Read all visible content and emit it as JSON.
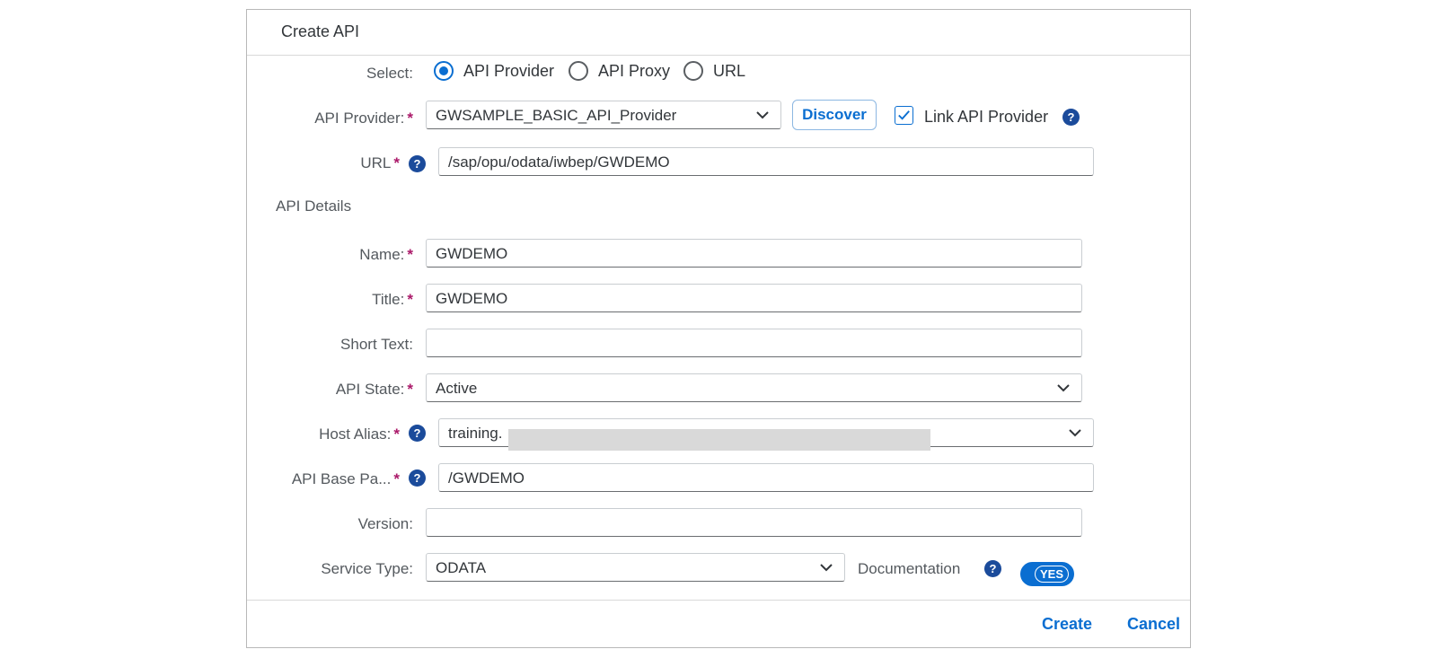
{
  "dialog": {
    "title": "Create API",
    "create_label": "Create",
    "cancel_label": "Cancel"
  },
  "select": {
    "label": "Select:",
    "options": [
      {
        "label": "API Provider",
        "checked": true
      },
      {
        "label": "API Proxy",
        "checked": false
      },
      {
        "label": "URL",
        "checked": false
      }
    ]
  },
  "api_provider": {
    "label": "API Provider:",
    "value": "GWSAMPLE_BASIC_API_Provider",
    "discover_label": "Discover",
    "link_label": "Link API Provider",
    "link_checked": true
  },
  "url": {
    "label": "URL",
    "value": "/sap/opu/odata/iwbep/GWDEMO"
  },
  "details": {
    "section_title": "API Details",
    "name": {
      "label": "Name:",
      "value": "GWDEMO"
    },
    "title": {
      "label": "Title:",
      "value": "GWDEMO"
    },
    "short_text": {
      "label": "Short Text:",
      "value": ""
    },
    "api_state": {
      "label": "API State:",
      "value": "Active"
    },
    "host_alias": {
      "label": "Host Alias:",
      "value": "training."
    },
    "base_path": {
      "label": "API Base Pa...",
      "value": "/GWDEMO"
    },
    "version": {
      "label": "Version:",
      "value": ""
    },
    "service_type": {
      "label": "Service Type:",
      "value": "ODATA"
    },
    "documentation": {
      "label": "Documentation",
      "toggle_label": "YES",
      "enabled": true
    }
  },
  "icons": {
    "help": "?",
    "required": "*"
  },
  "colors": {
    "accent": "#0a6ed1",
    "required": "#ab1a6a",
    "help_icon": "#1b4b9b"
  }
}
